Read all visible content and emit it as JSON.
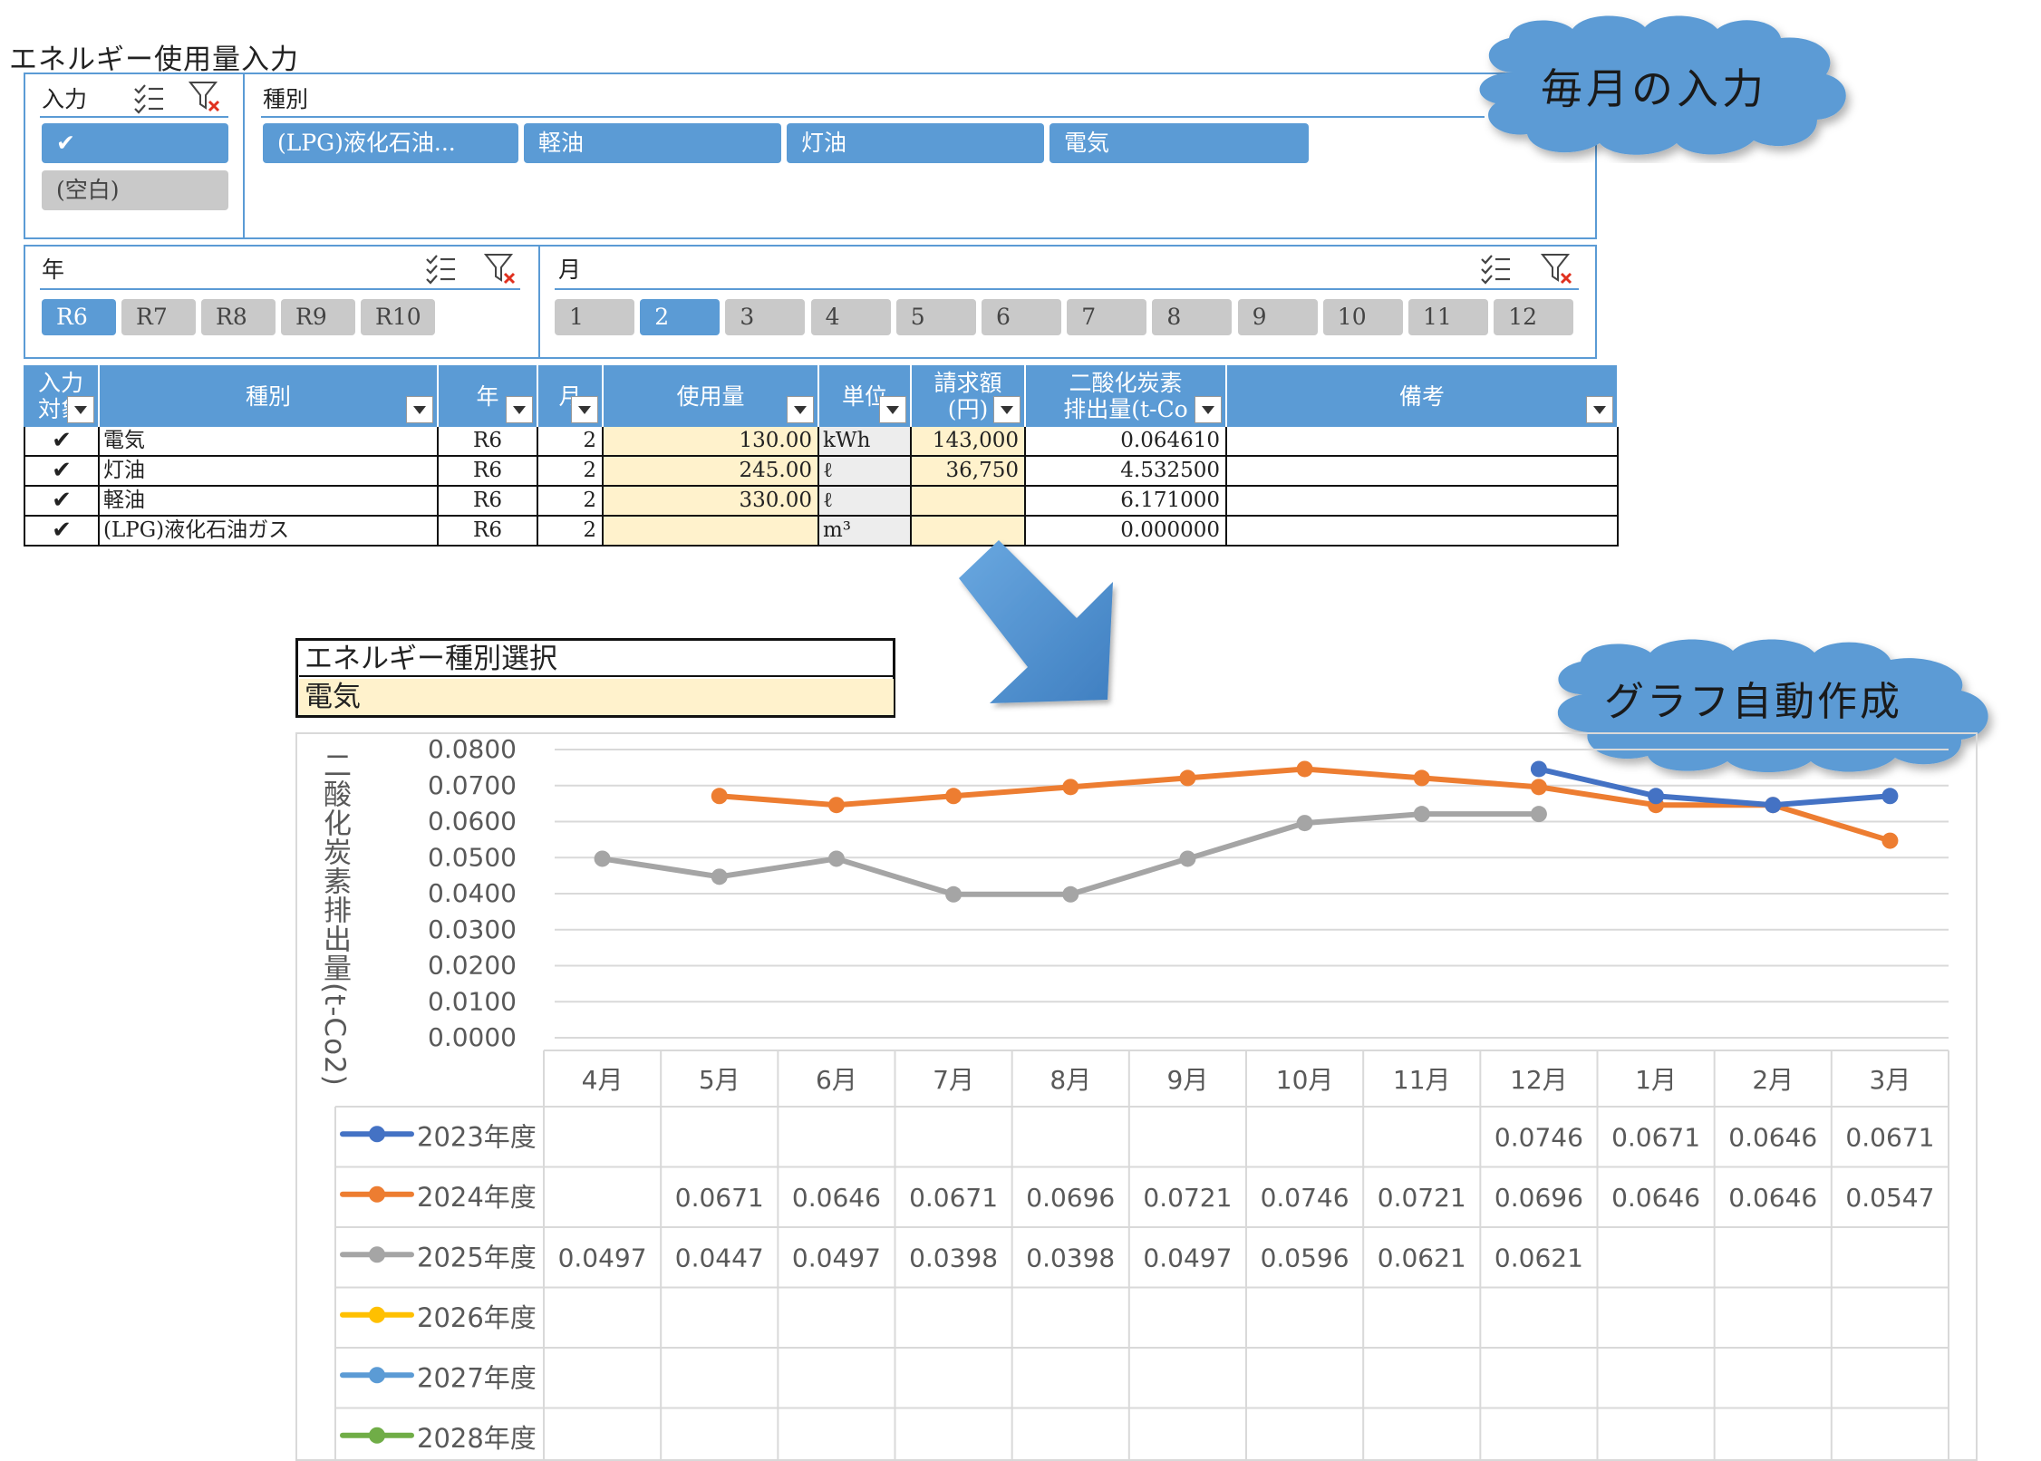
{
  "title": "エネルギー使用量入力",
  "callouts": {
    "top": "毎月の入力",
    "bottom": "グラフ自動作成"
  },
  "slicer_input": {
    "header": "入力",
    "items": [
      {
        "label": "✔",
        "selected": true
      },
      {
        "label": "(空白)",
        "selected": false
      }
    ]
  },
  "slicer_type": {
    "header": "種別",
    "items": [
      {
        "label": "(LPG)液化石油...",
        "selected": true
      },
      {
        "label": "軽油",
        "selected": true
      },
      {
        "label": "灯油",
        "selected": true
      },
      {
        "label": "電気",
        "selected": true
      }
    ]
  },
  "slicer_year": {
    "header": "年",
    "items": [
      {
        "label": "R6",
        "selected": true
      },
      {
        "label": "R7",
        "selected": false
      },
      {
        "label": "R8",
        "selected": false
      },
      {
        "label": "R9",
        "selected": false
      },
      {
        "label": "R10",
        "selected": false
      }
    ]
  },
  "slicer_month": {
    "header": "月",
    "items": [
      {
        "label": "1",
        "selected": false
      },
      {
        "label": "2",
        "selected": true
      },
      {
        "label": "3",
        "selected": false
      },
      {
        "label": "4",
        "selected": false
      },
      {
        "label": "5",
        "selected": false
      },
      {
        "label": "6",
        "selected": false
      },
      {
        "label": "7",
        "selected": false
      },
      {
        "label": "8",
        "selected": false
      },
      {
        "label": "9",
        "selected": false
      },
      {
        "label": "10",
        "selected": false
      },
      {
        "label": "11",
        "selected": false
      },
      {
        "label": "12",
        "selected": false
      }
    ]
  },
  "table": {
    "headers": [
      {
        "label": "入力\n対象"
      },
      {
        "label": "種別"
      },
      {
        "label": "年"
      },
      {
        "label": "月"
      },
      {
        "label": "使用量"
      },
      {
        "label": "単位"
      },
      {
        "label": "請求額\n(円)"
      },
      {
        "label": "二酸化炭素\n排出量(t-Co"
      },
      {
        "label": "備考"
      }
    ],
    "rows": [
      {
        "check": "✔",
        "type": "電気",
        "year": "R6",
        "month": "2",
        "usage": "130.00",
        "unit": "kWh",
        "amount": "143,000",
        "co2": "0.064610",
        "note": ""
      },
      {
        "check": "✔",
        "type": "灯油",
        "year": "R6",
        "month": "2",
        "usage": "245.00",
        "unit": "ℓ",
        "amount": "36,750",
        "co2": "4.532500",
        "note": ""
      },
      {
        "check": "✔",
        "type": "軽油",
        "year": "R6",
        "month": "2",
        "usage": "330.00",
        "unit": "ℓ",
        "amount": "",
        "co2": "6.171000",
        "note": ""
      },
      {
        "check": "✔",
        "type": "(LPG)液化石油ガス",
        "year": "R6",
        "month": "2",
        "usage": "",
        "unit": "m³",
        "amount": "",
        "co2": "0.000000",
        "note": ""
      }
    ]
  },
  "energy_select": {
    "label": "エネルギー種別選択",
    "value": "電気"
  },
  "colors": {
    "accent": "#5b9bd5",
    "input_yellow": "#fff2cc",
    "cloud": "#5b9bd5"
  },
  "chart_data": {
    "type": "line",
    "ylabel": "二酸化炭素排出量(t-Co2)",
    "ylim": [
      0,
      0.08
    ],
    "yticks": [
      "0.0800",
      "0.0700",
      "0.0600",
      "0.0500",
      "0.0400",
      "0.0300",
      "0.0200",
      "0.0100",
      "0.0000"
    ],
    "categories": [
      "4月",
      "5月",
      "6月",
      "7月",
      "8月",
      "9月",
      "10月",
      "11月",
      "12月",
      "1月",
      "2月",
      "3月"
    ],
    "grid": true,
    "legend": "data-table",
    "series": [
      {
        "name": "2023年度",
        "color": "#4472c4",
        "values": [
          null,
          null,
          null,
          null,
          null,
          null,
          null,
          null,
          0.0746,
          0.0671,
          0.0646,
          0.0671
        ],
        "labels": [
          "",
          "",
          "",
          "",
          "",
          "",
          "",
          "",
          "0.0746",
          "0.0671",
          "0.0646",
          "0.0671"
        ]
      },
      {
        "name": "2024年度",
        "color": "#ed7d31",
        "values": [
          null,
          0.0671,
          0.0646,
          0.0671,
          0.0696,
          0.0721,
          0.0746,
          0.0721,
          0.0696,
          0.0646,
          0.0646,
          0.0547
        ],
        "labels": [
          "",
          "0.0671",
          "0.0646",
          "0.0671",
          "0.0696",
          "0.0721",
          "0.0746",
          "0.0721",
          "0.0696",
          "0.0646",
          "0.0646",
          "0.0547"
        ]
      },
      {
        "name": "2025年度",
        "color": "#a5a5a5",
        "values": [
          0.0497,
          0.0447,
          0.0497,
          0.0398,
          0.0398,
          0.0497,
          0.0596,
          0.0621,
          0.0621,
          null,
          null,
          null
        ],
        "labels": [
          "0.0497",
          "0.0447",
          "0.0497",
          "0.0398",
          "0.0398",
          "0.0497",
          "0.0596",
          "0.0621",
          "0.0621",
          "",
          "",
          ""
        ]
      },
      {
        "name": "2026年度",
        "color": "#ffc000",
        "values": [
          null,
          null,
          null,
          null,
          null,
          null,
          null,
          null,
          null,
          null,
          null,
          null
        ],
        "labels": [
          "",
          "",
          "",
          "",
          "",
          "",
          "",
          "",
          "",
          "",
          "",
          ""
        ]
      },
      {
        "name": "2027年度",
        "color": "#5b9bd5",
        "values": [
          null,
          null,
          null,
          null,
          null,
          null,
          null,
          null,
          null,
          null,
          null,
          null
        ],
        "labels": [
          "",
          "",
          "",
          "",
          "",
          "",
          "",
          "",
          "",
          "",
          "",
          ""
        ]
      },
      {
        "name": "2028年度",
        "color": "#70ad47",
        "values": [
          null,
          null,
          null,
          null,
          null,
          null,
          null,
          null,
          null,
          null,
          null,
          null
        ],
        "labels": [
          "",
          "",
          "",
          "",
          "",
          "",
          "",
          "",
          "",
          "",
          "",
          ""
        ]
      }
    ]
  }
}
